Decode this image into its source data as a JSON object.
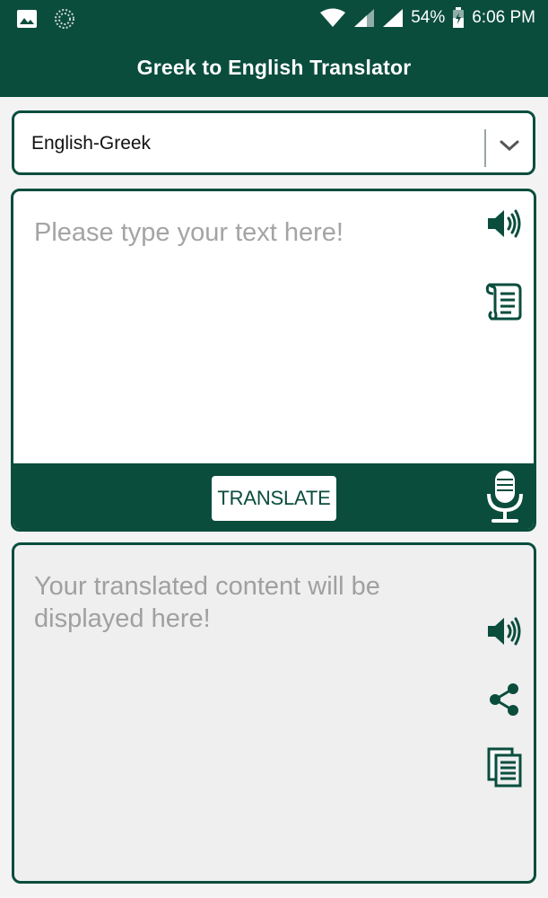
{
  "status_bar": {
    "battery": "54%",
    "time": "6:06 PM",
    "icons": [
      "gallery-icon",
      "loading-icon",
      "wifi-icon",
      "signal-icon",
      "signal-icon",
      "battery-charging-icon"
    ]
  },
  "app_bar": {
    "title": "Greek to English Translator"
  },
  "language_select": {
    "value": "English-Greek",
    "icon": "chevron-down-icon"
  },
  "input": {
    "placeholder": "Please type your text here!",
    "icons": [
      "speaker-icon",
      "scroll-icon"
    ]
  },
  "action_bar": {
    "translate_label": "TRANSLATE",
    "icon": "microphone-icon"
  },
  "output": {
    "placeholder": "Your translated content will be displayed here!",
    "icons": [
      "speaker-icon",
      "share-icon",
      "copy-icon"
    ]
  },
  "colors": {
    "primary": "#0a4d3d",
    "background": "#f3f3f3",
    "output_background": "#efeff0",
    "placeholder_text": "#a4a4a4"
  }
}
